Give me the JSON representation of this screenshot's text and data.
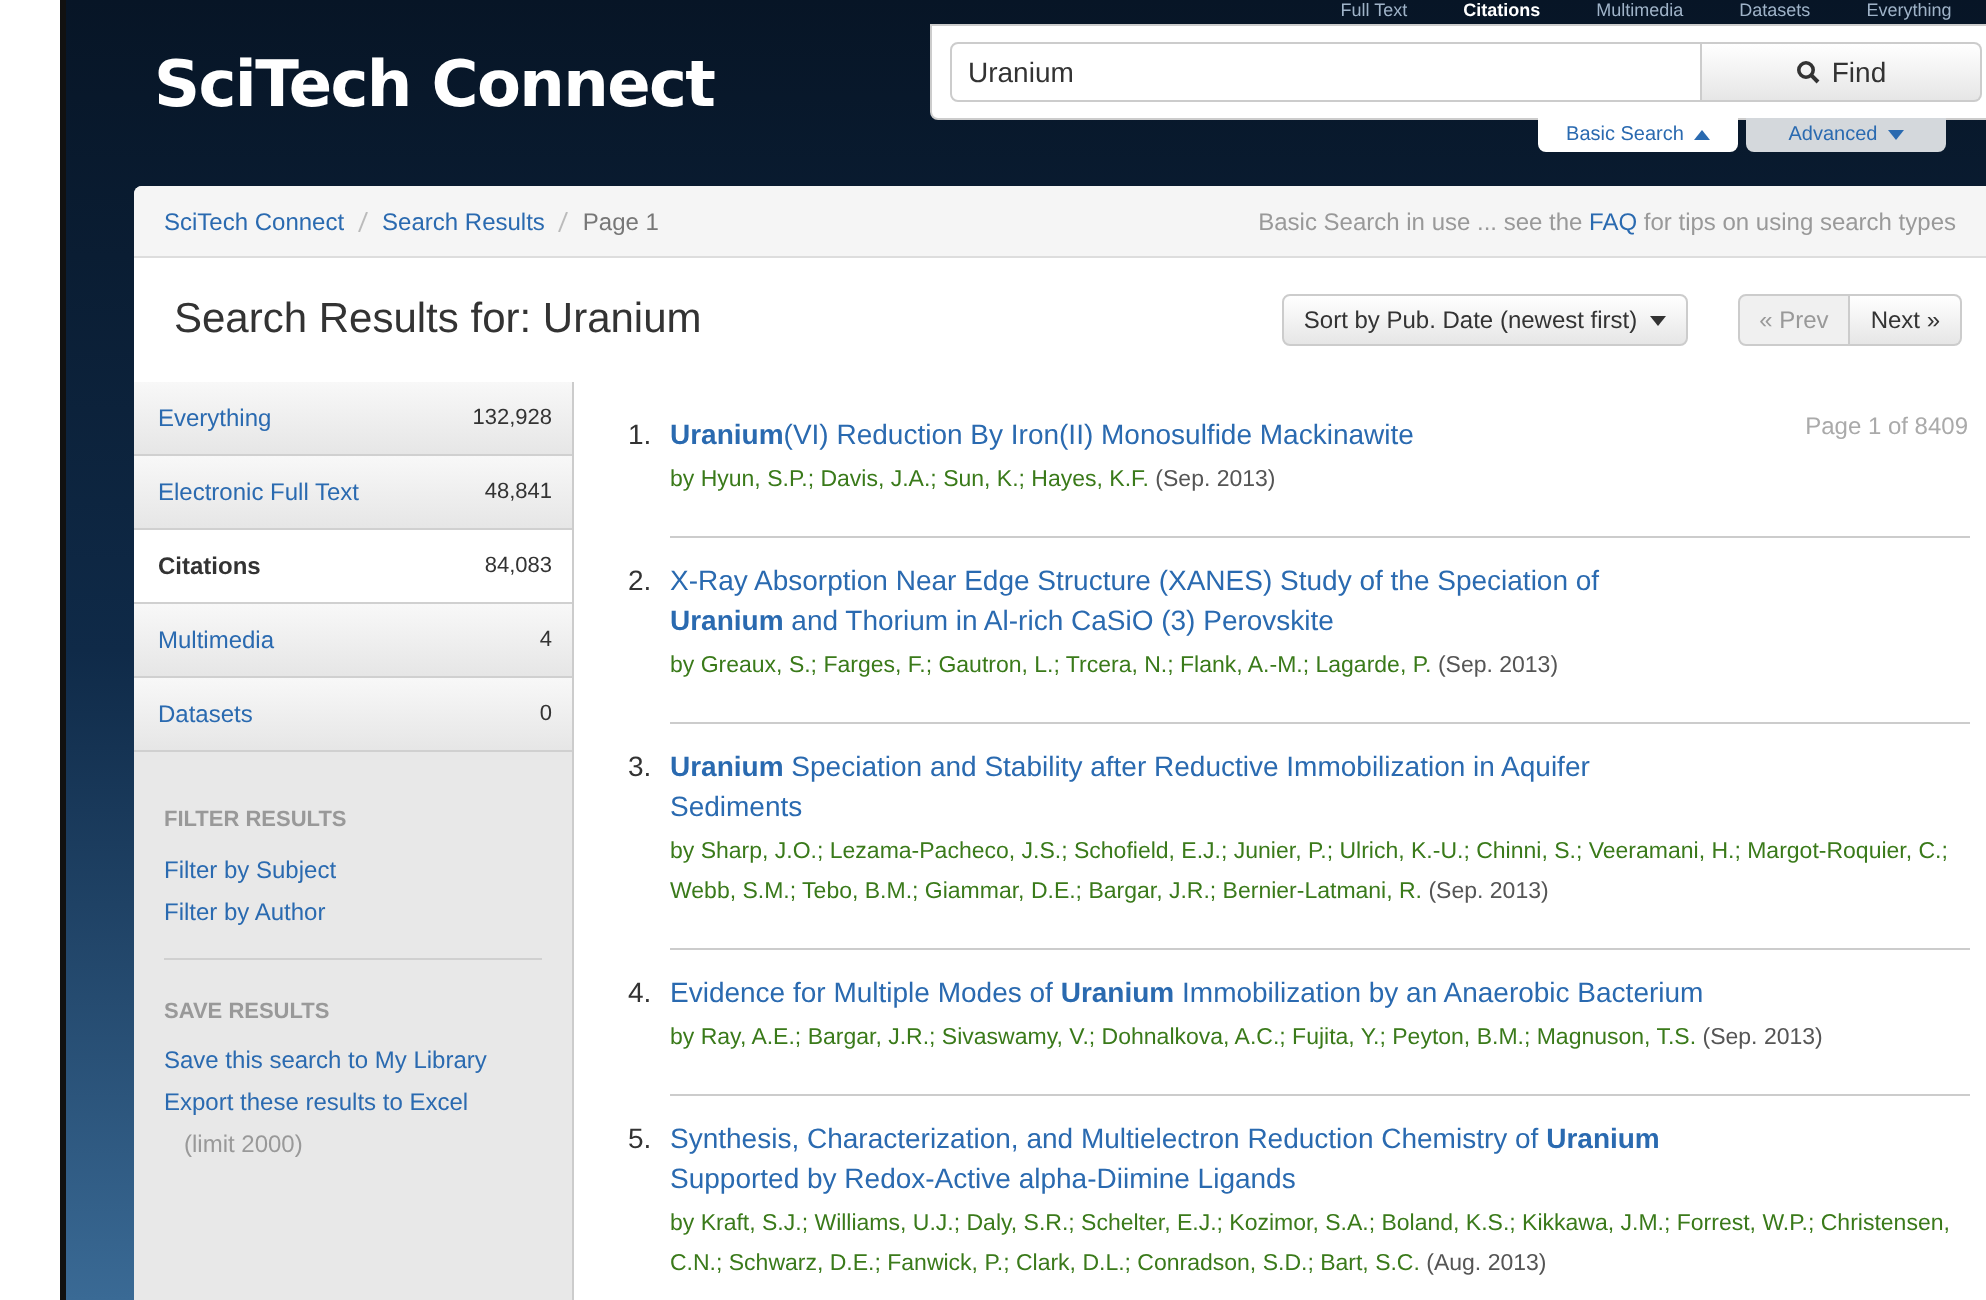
{
  "site_title": "SciTech Connect",
  "scope_tabs": [
    {
      "label": "Full Text",
      "selected": false
    },
    {
      "label": "Citations",
      "selected": true
    },
    {
      "label": "Multimedia",
      "selected": false
    },
    {
      "label": "Datasets",
      "selected": false
    },
    {
      "label": "Everything",
      "selected": false
    }
  ],
  "search": {
    "value": "Uranium",
    "button": "Find"
  },
  "search_modes": [
    {
      "label": "Basic Search",
      "selected": true
    },
    {
      "label": "Advanced",
      "selected": false
    }
  ],
  "breadcrumb": [
    "SciTech Connect",
    "Search Results",
    "Page 1"
  ],
  "search_hint": {
    "before": "Basic Search in use ... see the",
    "link": "FAQ",
    "after": "for tips on using search types"
  },
  "heading": "Search Results for: Uranium",
  "sort": "Sort by Pub. Date (newest first)",
  "pager": [
    {
      "label": "« Prev",
      "disabled": true
    },
    {
      "label": "Next »",
      "disabled": false
    }
  ],
  "categories": [
    {
      "label": "Everything",
      "count": "132,928",
      "selected": false
    },
    {
      "label": "Electronic Full Text",
      "count": "48,841",
      "selected": false
    },
    {
      "label": "Citations",
      "count": "84,083",
      "selected": true
    },
    {
      "label": "Multimedia",
      "count": "4",
      "selected": false
    },
    {
      "label": "Datasets",
      "count": "0",
      "selected": false
    }
  ],
  "sidebar_sections": [
    {
      "heading": "FILTER RESULTS",
      "links": [
        "Filter by Subject",
        "Filter by Author"
      ]
    },
    {
      "heading": "SAVE RESULTS",
      "links": [
        "Save this search to My Library",
        "Export these results to Excel"
      ],
      "note": "(limit 2000)"
    }
  ],
  "page_count": "Page 1 of 8409",
  "results": [
    {
      "number": "1.",
      "title": "**Uranium**(VI) Reduction By Iron(II) Monosulfide Mackinawite",
      "authors": "by Hyun, S.P.; Davis, J.A.; Sun, K.; Hayes, K.F.",
      "date": "(Sep. 2013)"
    },
    {
      "number": "2.",
      "title": "X-Ray Absorption Near Edge Structure (XANES) Study of the Speciation of **Uranium** and Thorium in Al-rich CaSiO (3) Perovskite",
      "authors": "by Greaux, S.; Farges, F.; Gautron, L.; Trcera, N.; Flank, A.-M.; Lagarde, P.",
      "date": "(Sep. 2013)"
    },
    {
      "number": "3.",
      "title": "**Uranium** Speciation and Stability after Reductive Immobilization in Aquifer Sediments",
      "authors": "by Sharp, J.O.; Lezama-Pacheco, J.S.; Schofield, E.J.; Junier, P.; Ulrich, K.-U.; Chinni, S.; Veeramani, H.; Margot-Roquier, C.; Webb, S.M.; Tebo, B.M.; Giammar, D.E.; Bargar, J.R.; Bernier-Latmani, R.",
      "date": "(Sep. 2013)"
    },
    {
      "number": "4.",
      "title": "Evidence for Multiple Modes of **Uranium** Immobilization by an Anaerobic Bacterium",
      "authors": "by Ray, A.E.; Bargar, J.R.; Sivaswamy, V.; Dohnalkova, A.C.; Fujita, Y.; Peyton, B.M.; Magnuson, T.S.",
      "date": "(Sep. 2013)"
    },
    {
      "number": "5.",
      "title": "Synthesis, Characterization, and Multielectron Reduction Chemistry of **Uranium** Supported by Redox-Active alpha-Diimine Ligands",
      "authors": "by Kraft, S.J.; Williams, U.J.; Daly, S.R.; Schelter, E.J.; Kozimor, S.A.; Boland, K.S.; Kikkawa, J.M.; Forrest, W.P.; Christensen, C.N.; Schwarz, D.E.; Fanwick, P.; Clark, D.L.; Conradson, S.D.; Bart, S.C.",
      "date": "(Aug. 2013)"
    }
  ]
}
